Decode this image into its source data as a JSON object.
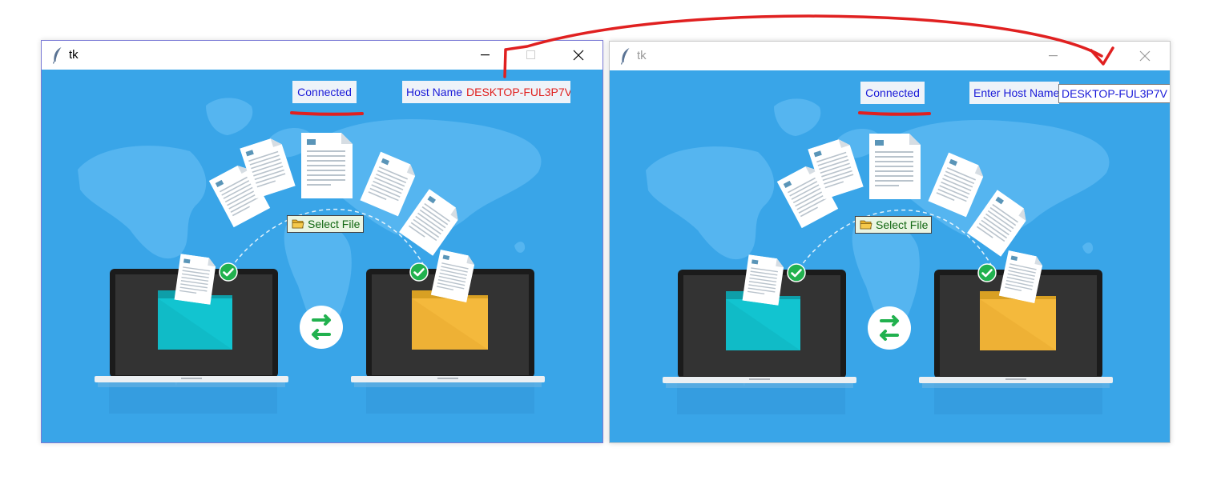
{
  "window_left": {
    "title": "tk",
    "status_label": "Connected",
    "host_label": "Host Name",
    "host_value": "DESKTOP-FUL3P7V",
    "select_button": "Select File"
  },
  "window_right": {
    "title": "tk",
    "status_label": "Connected",
    "host_label": "Enter Host Name",
    "host_value": "DESKTOP-FUL3P7V",
    "select_button": "Select File"
  },
  "colors": {
    "background": "#39a5e8",
    "annotation": "#e02020",
    "label_text": "#1a1ad8",
    "host_value_left": "#e0201e"
  },
  "icons": [
    "tk-feather-icon",
    "minimize-icon",
    "maximize-icon",
    "close-icon",
    "folder-icon",
    "check-icon",
    "swap-arrows-icon",
    "document-icon",
    "laptop-icon",
    "world-map"
  ]
}
